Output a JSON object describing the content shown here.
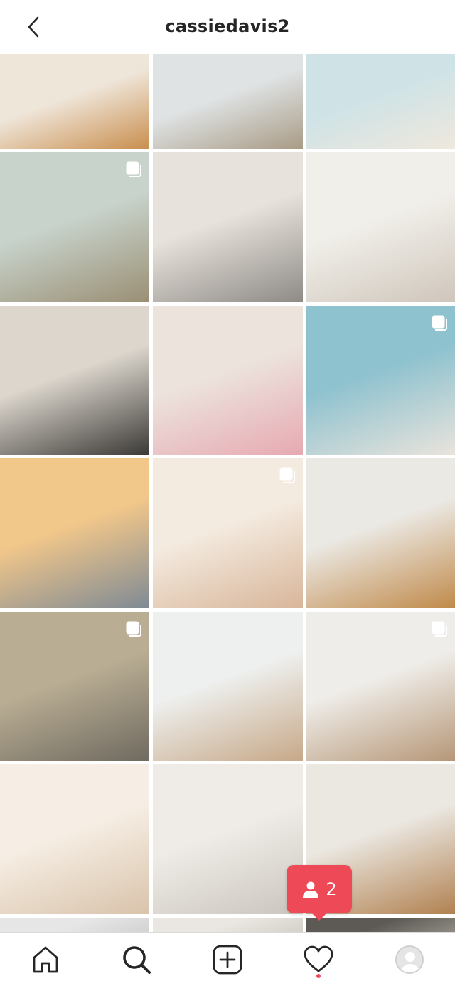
{
  "header": {
    "title": "cassiedavis2"
  },
  "grid": {
    "tiles": [
      {
        "name": "post-golden-retriever-closeup",
        "colors": [
          "#efe6da",
          "#c98f4f"
        ],
        "multi": false
      },
      {
        "name": "post-coffee-mug-pier",
        "colors": [
          "#dfe3e4",
          "#a99b86"
        ],
        "multi": false
      },
      {
        "name": "post-beach-sandals",
        "colors": [
          "#cfe3e6",
          "#efe8dd"
        ],
        "multi": false
      },
      {
        "name": "post-friends-at-wedding",
        "colors": [
          "#c8d3cc",
          "#9a8f74"
        ],
        "multi": true
      },
      {
        "name": "post-girls-dancing-street",
        "colors": [
          "#e7e2dc",
          "#8e8a85"
        ],
        "multi": false
      },
      {
        "name": "post-kitchen-high-five",
        "colors": [
          "#f1efea",
          "#cfc6bb"
        ],
        "multi": false
      },
      {
        "name": "post-golf-cart-selfie",
        "colors": [
          "#dcd6cd",
          "#3b3936"
        ],
        "multi": false
      },
      {
        "name": "post-girl-on-bike",
        "colors": [
          "#ece3dc",
          "#e6a9b2"
        ],
        "multi": false
      },
      {
        "name": "post-beach-bikini",
        "colors": [
          "#8fc2cf",
          "#e9e4dc"
        ],
        "multi": true
      },
      {
        "name": "post-sunset-beach-hug",
        "colors": [
          "#f2c78a",
          "#7f8a94"
        ],
        "multi": false
      },
      {
        "name": "post-kids-on-beach",
        "colors": [
          "#f4ebe0",
          "#d8b69a"
        ],
        "multi": true
      },
      {
        "name": "post-dog-with-mug",
        "colors": [
          "#ebe9e4",
          "#c08a4a"
        ],
        "multi": false
      },
      {
        "name": "post-friends-with-lambs",
        "colors": [
          "#b9ad93",
          "#6f6a60"
        ],
        "multi": true
      },
      {
        "name": "post-kids-on-log",
        "colors": [
          "#eef0ef",
          "#c7a888"
        ],
        "multi": false
      },
      {
        "name": "post-portrait-smile",
        "colors": [
          "#efede9",
          "#b69777"
        ],
        "multi": true
      },
      {
        "name": "post-pier-sunset-kids",
        "colors": [
          "#f6eee4",
          "#d9c3ab"
        ],
        "multi": false
      },
      {
        "name": "post-toddler-kitchen",
        "colors": [
          "#efece7",
          "#cbc5be"
        ],
        "multi": false
      },
      {
        "name": "post-dog-on-porch",
        "colors": [
          "#ebe8e2",
          "#b18150"
        ],
        "multi": false
      },
      {
        "name": "post-partial-1",
        "colors": [
          "#e6e6e6",
          "#cfcfcf"
        ],
        "multi": false
      },
      {
        "name": "post-partial-2",
        "colors": [
          "#eae7e2",
          "#d1ccc5"
        ],
        "multi": false
      },
      {
        "name": "post-partial-3",
        "colors": [
          "#5d5a55",
          "#9a958e"
        ],
        "multi": false
      }
    ]
  },
  "notification": {
    "count": "2",
    "color": "#ed4956"
  },
  "tabbar": {
    "items": [
      "home-icon",
      "search-icon",
      "new-post-icon",
      "activity-heart-icon",
      "profile-avatar"
    ],
    "active": "search-icon"
  }
}
